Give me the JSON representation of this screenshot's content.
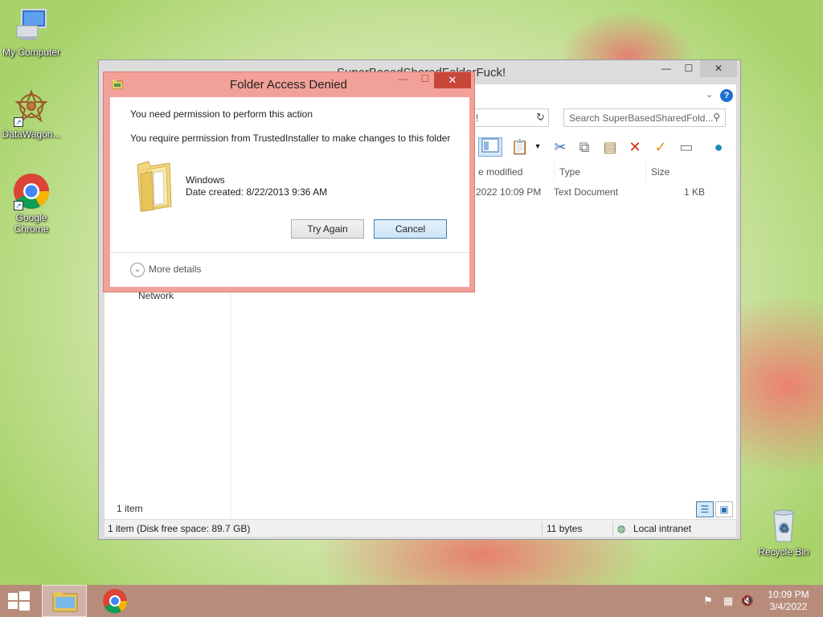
{
  "desktop": {
    "icons": [
      {
        "label": "My Computer",
        "icon": "computer-icon"
      },
      {
        "label": "DataWagon...",
        "icon": "datawagon-icon"
      },
      {
        "label": "Google Chrome",
        "icon": "chrome-icon"
      },
      {
        "label": "Recycle Bin",
        "icon": "recycle-bin-icon"
      }
    ]
  },
  "explorer": {
    "title": "SuperBasedSharedFolderFuck!",
    "address_value": "!",
    "search_placeholder": "Search SuperBasedSharedFold...",
    "columns": [
      "e modified",
      "Type",
      "Size"
    ],
    "rows": [
      {
        "modified": "2022 10:09 PM",
        "type": "Text Document",
        "size": "1 KB"
      }
    ],
    "nav_network": "Network",
    "item_count": "1 item",
    "status": {
      "left": "1 item (Disk free space: 89.7 GB)",
      "bytes": "11 bytes",
      "zone": "Local intranet"
    }
  },
  "dialog": {
    "title": "Folder Access Denied",
    "message1": "You need permission to perform this action",
    "message2": "You require permission from TrustedInstaller to make changes to this folder",
    "file_name": "Windows",
    "file_date": "Date created: 8/22/2013 9:36 AM",
    "try_again_label": "Try Again",
    "cancel_label": "Cancel",
    "more_details_label": "More details"
  },
  "taskbar": {
    "time": "10:09 PM",
    "date": "3/4/2022"
  },
  "colors": {
    "dialog_frame": "#f2a198",
    "close_button": "#c7463a",
    "taskbar": "#b88c7b"
  }
}
